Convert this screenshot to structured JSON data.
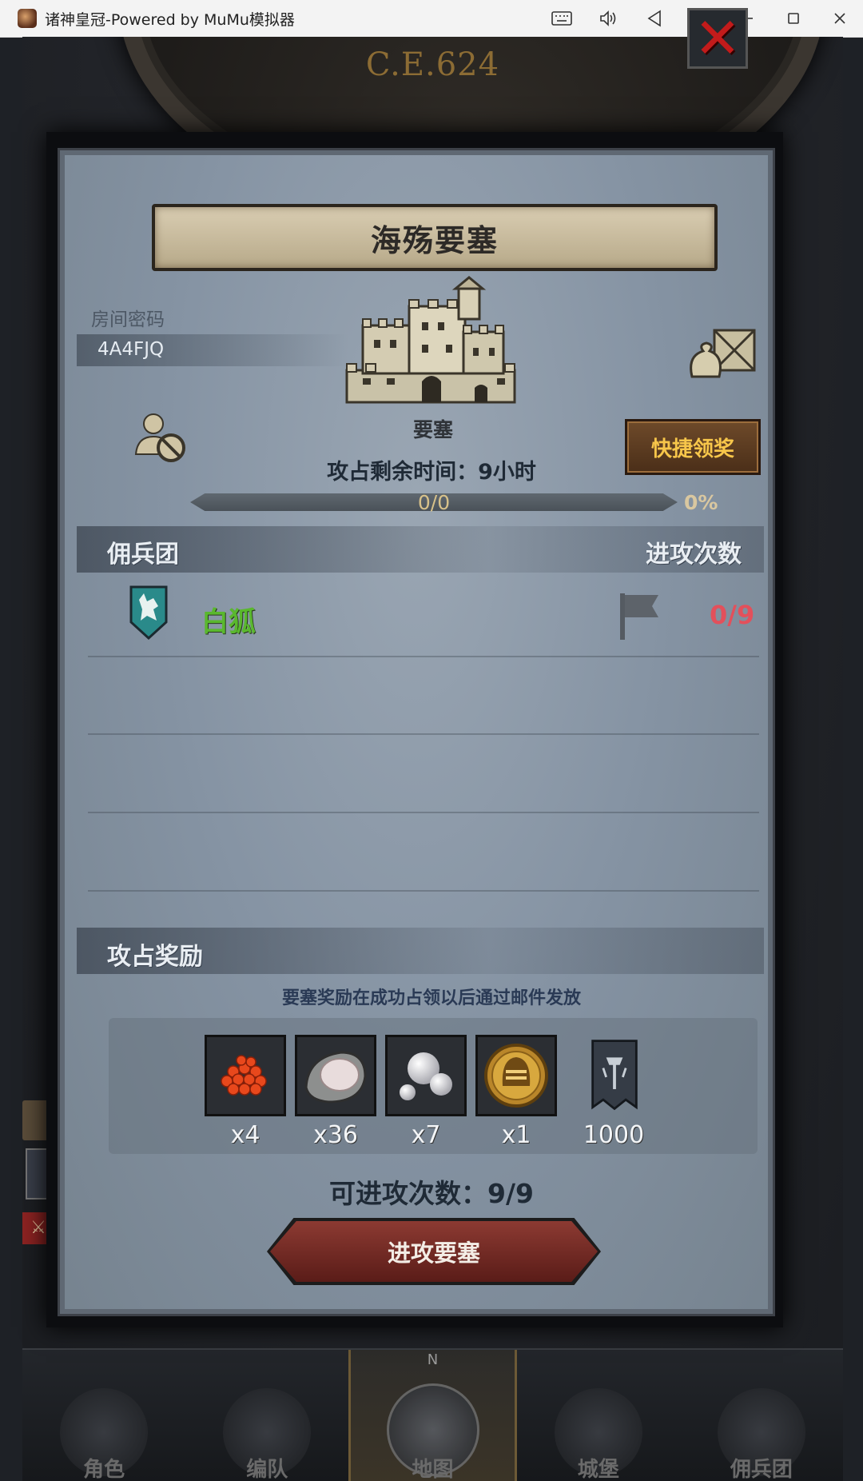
{
  "window": {
    "title": "诸神皇冠-Powered by MuMu模拟器",
    "controls": [
      "keyboard-icon",
      "volume-icon",
      "back-icon",
      "more-icon",
      "minimize-icon",
      "maximize-icon",
      "close-icon"
    ]
  },
  "background": {
    "era": "C.E.624"
  },
  "modal": {
    "title": "海殇要塞",
    "room_label": "房间密码",
    "room_code": "4A4FJQ",
    "fortress_label": "要塞",
    "quick_claim": "快捷领奖",
    "timer": "攻占剩余时间：9小时",
    "progress_text": "0/0",
    "progress_fraction": 0,
    "progress_pct": "0%",
    "mercenary_header": "佣兵团",
    "attack_count_header": "进攻次数",
    "guilds": [
      {
        "name": "白狐",
        "count": "0/9"
      }
    ],
    "reward_header": "攻占奖励",
    "reward_note": "要塞奖励在成功占领以后通过邮件发放",
    "rewards": [
      {
        "icon": "fish-roe-icon",
        "qty": "x4"
      },
      {
        "icon": "oyster-icon",
        "qty": "x36"
      },
      {
        "icon": "pearl-icon",
        "qty": "x7"
      },
      {
        "icon": "helmet-coin-icon",
        "qty": "x1"
      },
      {
        "icon": "war-banner-icon",
        "qty": "1000"
      }
    ],
    "attempts": "可进攻次数：9/9",
    "attack_button": "进攻要塞"
  },
  "bottom_nav": [
    {
      "label": "角色",
      "active": false
    },
    {
      "label": "编队",
      "active": false
    },
    {
      "label": "地图",
      "active": true
    },
    {
      "label": "城堡",
      "active": false
    },
    {
      "label": "佣兵团",
      "active": false
    }
  ],
  "colors": {
    "guild_name": "#5ab82e",
    "attack_count": "#e3505b",
    "quick_claim_text": "#f7c64a",
    "close_x": "#c21b1b"
  }
}
